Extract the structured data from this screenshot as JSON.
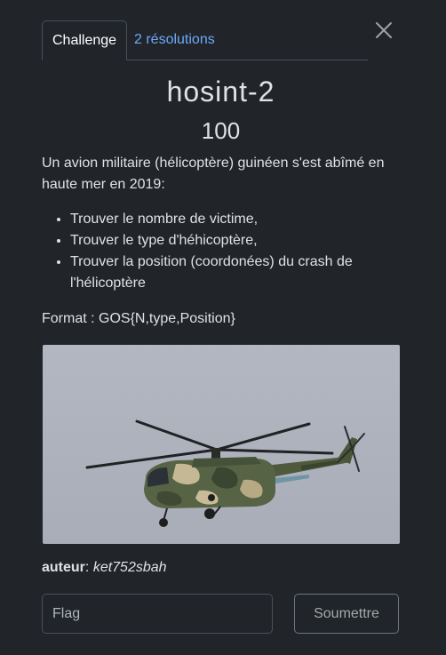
{
  "tabs": [
    {
      "label": "Challenge",
      "active": true
    },
    {
      "label": "2 résolutions",
      "active": false
    }
  ],
  "challenge": {
    "name": "hosint-2",
    "points": "100",
    "description": "Un avion militaire (hélicoptère) guinéen s'est abîmé en haute mer en 2019:",
    "tasks": [
      "Trouver le nombre de victime,",
      "Trouver le type d'héhicoptère,",
      "Trouver la position (coordonées) du crash de l'hélicoptère"
    ],
    "format": "Format : GOS{N,type,Position}",
    "author_label": "auteur",
    "author_sep": ":",
    "author_name": "ket752sbah"
  },
  "form": {
    "flag_placeholder": "Flag",
    "flag_value": "",
    "submit_label": "Soumettre"
  },
  "icons": {
    "close": "close-icon",
    "photo": "helicopter-image"
  },
  "colors": {
    "background": "#212529",
    "link": "#6ea8fe",
    "border": "#495057",
    "sky": "#aeb2bc"
  }
}
